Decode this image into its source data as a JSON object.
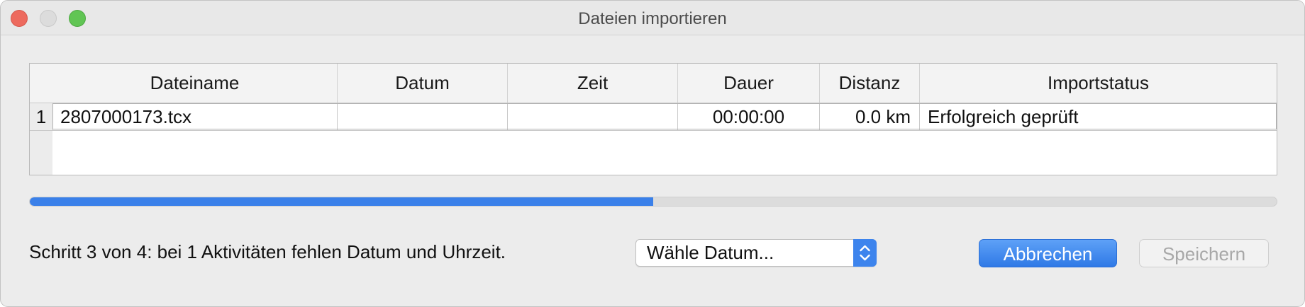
{
  "window": {
    "title": "Dateien importieren"
  },
  "table": {
    "columns": [
      "Dateiname",
      "Datum",
      "Zeit",
      "Dauer",
      "Distanz",
      "Importstatus"
    ],
    "rows": [
      {
        "index": "1",
        "filename": "2807000173.tcx",
        "date": "",
        "time": "",
        "duration": "00:00:00",
        "distance": "0.0 km",
        "status": "Erfolgreich geprüft"
      }
    ]
  },
  "progress": {
    "fraction": 0.5
  },
  "footer": {
    "status_text": "Schritt 3 von 4: bei 1 Aktivitäten fehlen Datum und Uhrzeit.",
    "date_select_value": "Wähle Datum...",
    "cancel_label": "Abbrechen",
    "save_label": "Speichern"
  },
  "colors": {
    "accent": "#3a80e9",
    "close": "#ed6a5e",
    "zoom": "#61c554"
  }
}
